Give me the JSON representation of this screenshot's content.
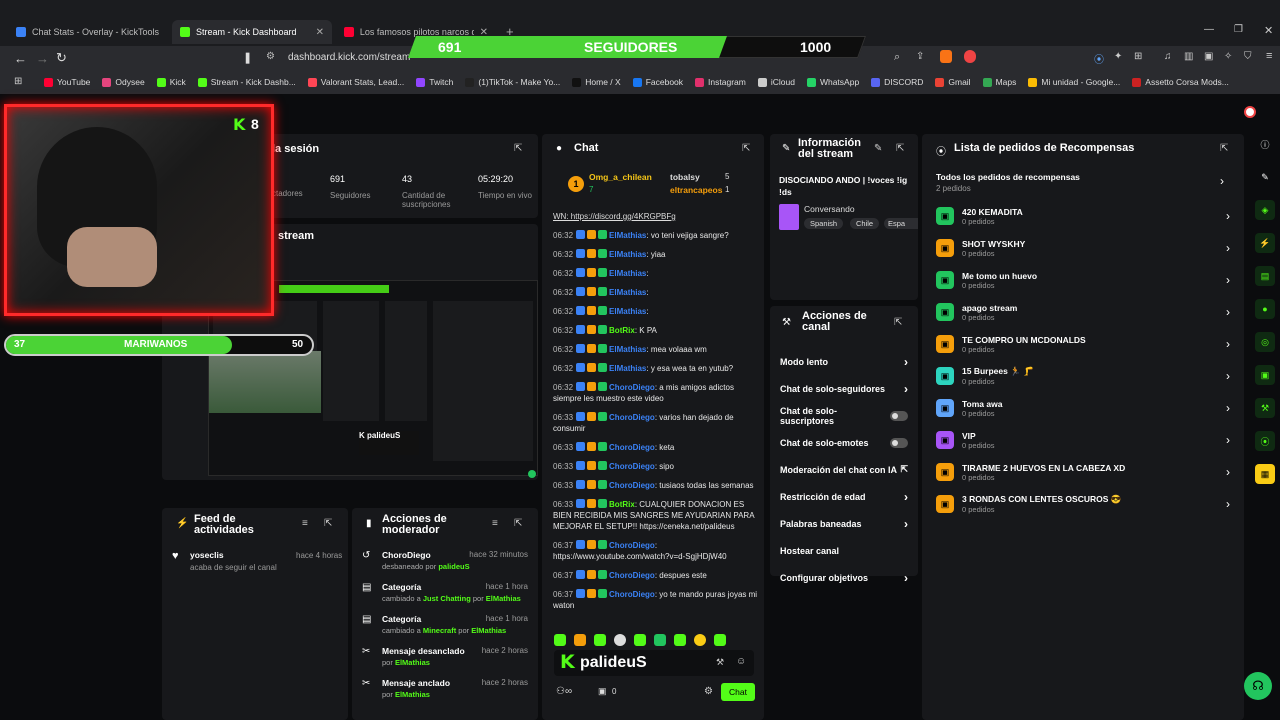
{
  "browser": {
    "tabs": [
      {
        "title": "Chat Stats - Overlay - KickTools",
        "color": "#3b82f6"
      },
      {
        "title": "Stream - Kick Dashboard",
        "color": "#53fc18"
      },
      {
        "title": "Los famosos pilotos narcos de M",
        "color": "#ff0033"
      }
    ],
    "url": "dashboard.kick.com/stream",
    "bookmarks": [
      {
        "label": "YouTube",
        "color": "#ff0033"
      },
      {
        "label": "Odysee",
        "color": "#e5457e"
      },
      {
        "label": "Kick",
        "color": "#53fc18"
      },
      {
        "label": "Stream - Kick Dashb...",
        "color": "#53fc18"
      },
      {
        "label": "Valorant Stats, Lead...",
        "color": "#ff4655"
      },
      {
        "label": "Twitch",
        "color": "#9146ff"
      },
      {
        "label": "(1)TikTok - Make Yo...",
        "color": "#222222"
      },
      {
        "label": "Home / X",
        "color": "#111111"
      },
      {
        "label": "Facebook",
        "color": "#1877f2"
      },
      {
        "label": "Instagram",
        "color": "#e1306c"
      },
      {
        "label": "iCloud",
        "color": "#cccccc"
      },
      {
        "label": "WhatsApp",
        "color": "#25d366"
      },
      {
        "label": "DISCORD",
        "color": "#5865f2"
      },
      {
        "label": "Gmail",
        "color": "#ea4335"
      },
      {
        "label": "Maps",
        "color": "#34a853"
      },
      {
        "label": "Mi unidad - Google...",
        "color": "#fbbc04"
      },
      {
        "label": "Assetto Corsa Mods...",
        "color": "#cc2222"
      }
    ]
  },
  "overlay": {
    "followers_current": "691",
    "followers_label": "SEGUIDORES",
    "followers_goal": "1000",
    "followers_progress": 0.691,
    "sub_current": "37",
    "sub_label": "MARIWANOS",
    "sub_goal": "50",
    "sub_progress": 0.74,
    "cam_badge": "8"
  },
  "session": {
    "title": "la sesión",
    "stats": [
      {
        "value": "",
        "label": "ctadores"
      },
      {
        "value": "691",
        "label": "Seguidores"
      },
      {
        "value": "43",
        "label": "Cantidad de suscripciones"
      },
      {
        "value": "05:29:20",
        "label": "Tiempo en vivo"
      }
    ],
    "stream_label": "stream"
  },
  "chat": {
    "title": "Chat",
    "top_gifter": {
      "name": "Omg_a_chilean",
      "count": "7"
    },
    "gifters": [
      {
        "name": "tobalsy",
        "count": "5"
      },
      {
        "name": "eltrancapeos",
        "count": "1"
      }
    ],
    "pinned": "WN: https://discord.gg/4KRGPBFg",
    "messages": [
      {
        "time": "06:32",
        "user": "ElMathias",
        "text": ": vo teni vejiga sangre?",
        "color": "#3b82f6"
      },
      {
        "time": "06:32",
        "user": "ElMathias",
        "text": ": yiaa",
        "color": "#3b82f6"
      },
      {
        "time": "06:32",
        "user": "ElMathias",
        "text": ":",
        "color": "#3b82f6"
      },
      {
        "time": "06:32",
        "user": "ElMathias",
        "text": ":",
        "color": "#3b82f6"
      },
      {
        "time": "06:32",
        "user": "ElMathias",
        "text": ":",
        "color": "#3b82f6"
      },
      {
        "time": "06:32",
        "user": "BotRix",
        "text": ": K PA",
        "color": "#53fc18"
      },
      {
        "time": "06:32",
        "user": "ElMathias",
        "text": ": mea volaaa wm",
        "color": "#3b82f6"
      },
      {
        "time": "06:32",
        "user": "ElMathias",
        "text": ": y esa wea ta en yutub?",
        "color": "#3b82f6"
      },
      {
        "time": "06:32",
        "user": "ChoroDiego",
        "text": ": a mis amigos adictos siempre les muestro este video",
        "color": "#3b82f6"
      },
      {
        "time": "06:33",
        "user": "ChoroDiego",
        "text": ": varios han dejado de consumir",
        "color": "#3b82f6"
      },
      {
        "time": "06:33",
        "user": "ChoroDiego",
        "text": ": keta",
        "color": "#3b82f6"
      },
      {
        "time": "06:33",
        "user": "ChoroDiego",
        "text": ": sipo",
        "color": "#3b82f6"
      },
      {
        "time": "06:33",
        "user": "ChoroDiego",
        "text": ": tusiaos todas las semanas",
        "color": "#3b82f6"
      },
      {
        "time": "06:33",
        "user": "BotRix",
        "text": ": CUALQUIER DONACION ES BIEN RECIBIDA MIS SANGRES ME AYUDARIAN PARA MEJORAR EL SETUP!! https://ceneka.net/palideus",
        "color": "#53fc18"
      },
      {
        "time": "06:37",
        "user": "ChoroDiego",
        "text": ": https://www.youtube.com/watch?v=d-SgjHDjW40",
        "color": "#3b82f6"
      },
      {
        "time": "06:37",
        "user": "ChoroDiego",
        "text": ": despues este",
        "color": "#3b82f6"
      },
      {
        "time": "06:37",
        "user": "ChoroDiego",
        "text": ": yo te mando puras joyas mi waton",
        "color": "#3b82f6"
      }
    ],
    "brand": "palideuS",
    "viewer_count": "0",
    "send_label": "Chat"
  },
  "stream_info": {
    "title": "Información del stream",
    "stream_title": "DISOCIANDO ANDO | !voces !ig !ds",
    "category": "Conversando",
    "tags": [
      "Spanish",
      "Chile",
      "Espa"
    ]
  },
  "channel_actions": {
    "title": "Acciones de canal",
    "items": [
      {
        "label": "Modo lento",
        "kind": "chevron"
      },
      {
        "label": "Chat de solo-seguidores",
        "kind": "chevron"
      },
      {
        "label": "Chat de solo-suscriptores",
        "kind": "toggle"
      },
      {
        "label": "Chat de solo-emotes",
        "kind": "toggle"
      },
      {
        "label": "Moderación del chat con IA",
        "kind": "external"
      },
      {
        "label": "Restricción de edad",
        "kind": "chevron"
      },
      {
        "label": "Palabras baneadas",
        "kind": "chevron"
      },
      {
        "label": "Hostear canal",
        "kind": "none"
      },
      {
        "label": "Configurar objetivos",
        "kind": "chevron"
      }
    ]
  },
  "rewards": {
    "title": "Lista de pedidos de Recompensas",
    "all_label": "Todos los pedidos de recompensas",
    "all_count": "2 pedidos",
    "items": [
      {
        "name": "420 KEMADITA",
        "count": "0 pedidos",
        "color": "#22c55e"
      },
      {
        "name": "SHOT WYSKHY",
        "count": "0 pedidos",
        "color": "#f59e0b"
      },
      {
        "name": "Me tomo un huevo",
        "count": "0 pedidos",
        "color": "#22c55e"
      },
      {
        "name": "apago stream",
        "count": "0 pedidos",
        "color": "#22c55e"
      },
      {
        "name": "TE COMPRO UN MCDONALDS",
        "count": "0 pedidos",
        "color": "#f59e0b"
      },
      {
        "name": "15 Burpees 🏃 🦵",
        "count": "0 pedidos",
        "color": "#2dd4bf"
      },
      {
        "name": "Toma awa",
        "count": "0 pedidos",
        "color": "#60a5fa"
      },
      {
        "name": "VIP",
        "count": "0 pedidos",
        "color": "#a855f7"
      },
      {
        "name": "TIRARME 2 HUEVOS EN LA CABEZA XD",
        "count": "0 pedidos",
        "color": "#f59e0b"
      },
      {
        "name": "3 RONDAS CON LENTES OSCUROS 😎",
        "count": "0 pedidos",
        "color": "#f59e0b"
      }
    ]
  },
  "activity_feed": {
    "title": "Feed de actividades",
    "items": [
      {
        "user": "yoseclis",
        "action": "acaba de seguir el canal",
        "time": "hace 4 horas"
      }
    ]
  },
  "mod_actions": {
    "title": "Acciones de moderador",
    "items": [
      {
        "title": "ChoroDiego",
        "time": "hace 32 minutos",
        "pre": "desbaneado por ",
        "hl": "palideuS",
        "mid": "",
        "hl2": ""
      },
      {
        "title": "Categoría",
        "time": "hace 1 hora",
        "pre": "cambiado a ",
        "hl": "Just Chatting",
        "mid": " por ",
        "hl2": "ElMathias"
      },
      {
        "title": "Categoría",
        "time": "hace 1 hora",
        "pre": "cambiado a ",
        "hl": "Minecraft",
        "mid": " por ",
        "hl2": "ElMathias"
      },
      {
        "title": "Mensaje desanclado",
        "time": "hace 2 horas",
        "pre": "por ",
        "hl": "ElMathias",
        "mid": "",
        "hl2": ""
      },
      {
        "title": "Mensaje anclado",
        "time": "hace 2 horas",
        "pre": "por ",
        "hl": "ElMathias",
        "mid": "",
        "hl2": ""
      }
    ]
  }
}
